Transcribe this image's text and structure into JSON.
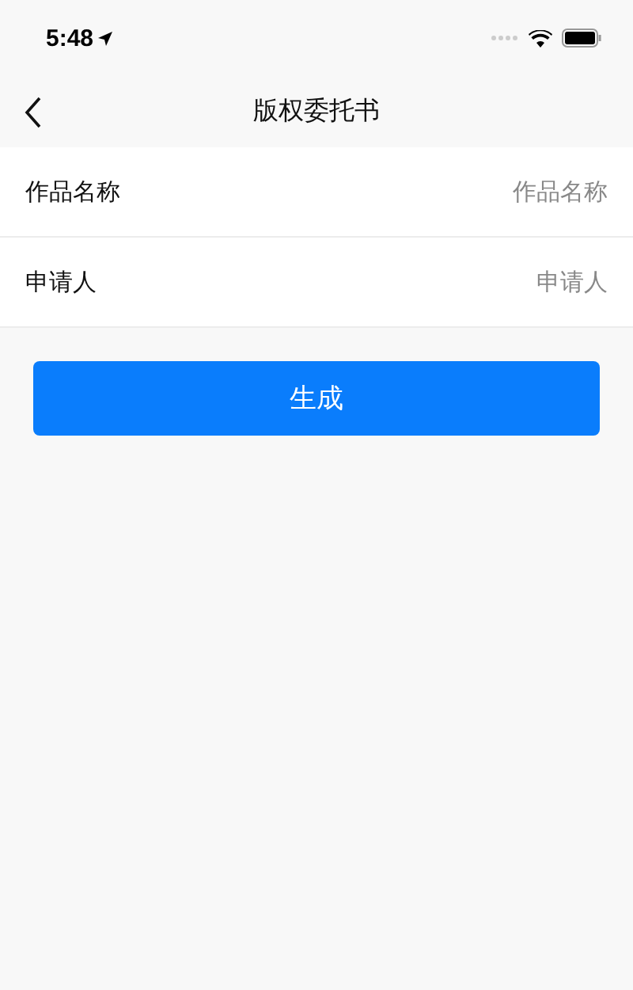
{
  "status_bar": {
    "time": "5:48"
  },
  "nav": {
    "title": "版权委托书"
  },
  "fields": [
    {
      "label": "作品名称",
      "placeholder": "作品名称"
    },
    {
      "label": "申请人",
      "placeholder": "申请人"
    }
  ],
  "button": "生成"
}
